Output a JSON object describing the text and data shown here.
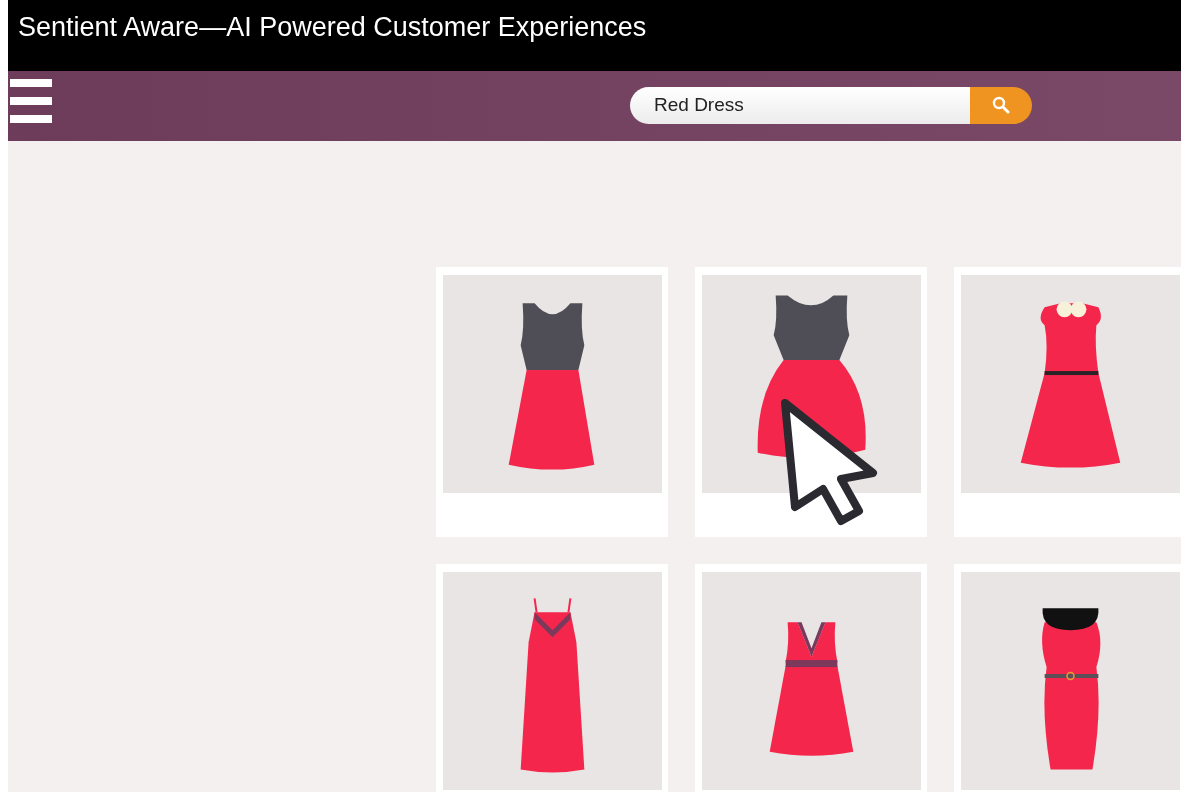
{
  "window": {
    "title": "Sentient Aware—AI Powered Customer Experiences"
  },
  "search": {
    "value": "Red Dress"
  },
  "products": [
    {
      "kind": "two-tone",
      "hovered": false
    },
    {
      "kind": "full-skirt",
      "hovered": true
    },
    {
      "kind": "collar",
      "hovered": false
    },
    {
      "kind": "maxi",
      "hovered": false
    },
    {
      "kind": "v-neck",
      "hovered": false
    },
    {
      "kind": "black-collar",
      "hovered": false
    }
  ]
}
